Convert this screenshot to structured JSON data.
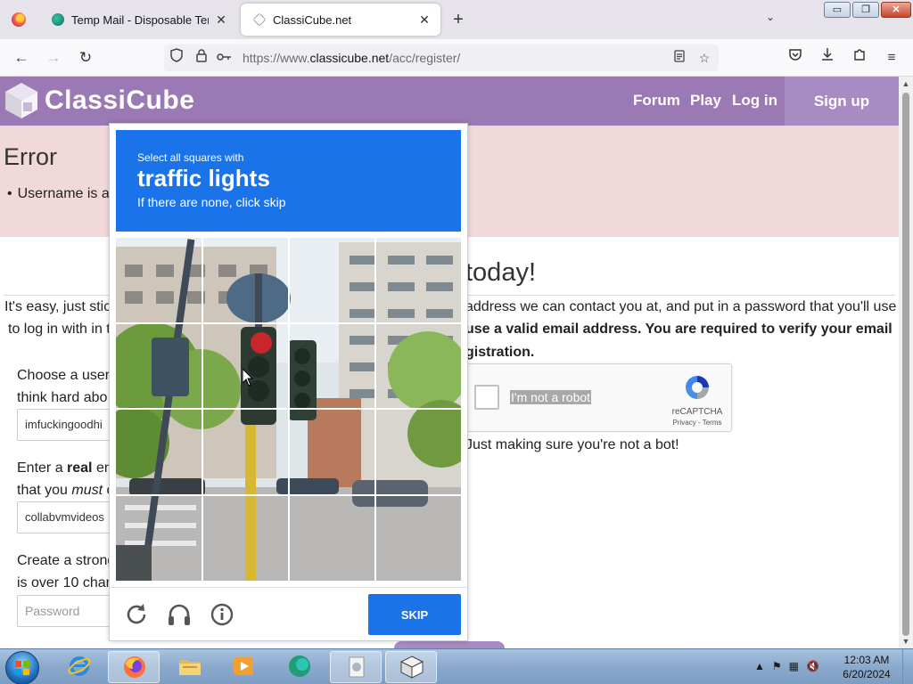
{
  "browser": {
    "tabs": [
      {
        "title": "Temp Mail - Disposable Tempo",
        "close": "✕"
      },
      {
        "title": "ClassiCube.net",
        "close": "✕"
      }
    ],
    "new_tab": "+",
    "tab_list": "⌄",
    "window_buttons": {
      "minimize": "▭",
      "restore": "❐",
      "close": "✕"
    },
    "url_prefix": "https://www.",
    "url_host": "classicube.net",
    "url_path": "/acc/register/"
  },
  "site": {
    "logo_text": "ClassiCube",
    "nav": {
      "forum": "Forum",
      "play": "Play",
      "login": "Log in",
      "signup": "Sign up"
    },
    "error": {
      "title": "Error",
      "item": "Username is a"
    },
    "heading": "today!",
    "intro": {
      "line1_left": "It's easy, just stic",
      "line1_right": "address we can contact you at, and put in a password that you'll use",
      "line2_left": "to log in with in t",
      "line2_right_bold": "use a valid email address. You are required to verify your email",
      "line3_right_bold": "gistration."
    },
    "form": {
      "username_label_1": "Choose a user",
      "username_label_2": "think hard abo",
      "username_value": "imfuckingoodhi",
      "email_label_1_pre": "Enter a ",
      "email_label_1_bold": "real",
      "email_label_1_post": " em",
      "email_label_2_pre": "that you ",
      "email_label_2_em": "must",
      "email_label_2_post": " c",
      "email_value": "collabvmvideos",
      "password_label_1": "Create a strong",
      "password_label_2": "is over 10 char",
      "password_placeholder": "Password"
    },
    "recaptcha": {
      "label": "I'm not a robot",
      "brand": "reCAPTCHA",
      "links": "Privacy - Terms"
    },
    "bot_note": "Just making sure you're not a bot!"
  },
  "challenge": {
    "instruction_small": "Select all squares with",
    "instruction_big": "traffic lights",
    "instruction_sub": "If there are none, click skip",
    "skip_label": "SKIP",
    "icons": [
      "reload-icon",
      "audio-icon",
      "info-icon"
    ]
  },
  "taskbar": {
    "time": "12:03 AM",
    "date": "6/20/2024"
  },
  "colors": {
    "brand_purple": "#9b79b5",
    "error_bg": "#f2d9d9",
    "captcha_blue": "#1a73e8"
  }
}
